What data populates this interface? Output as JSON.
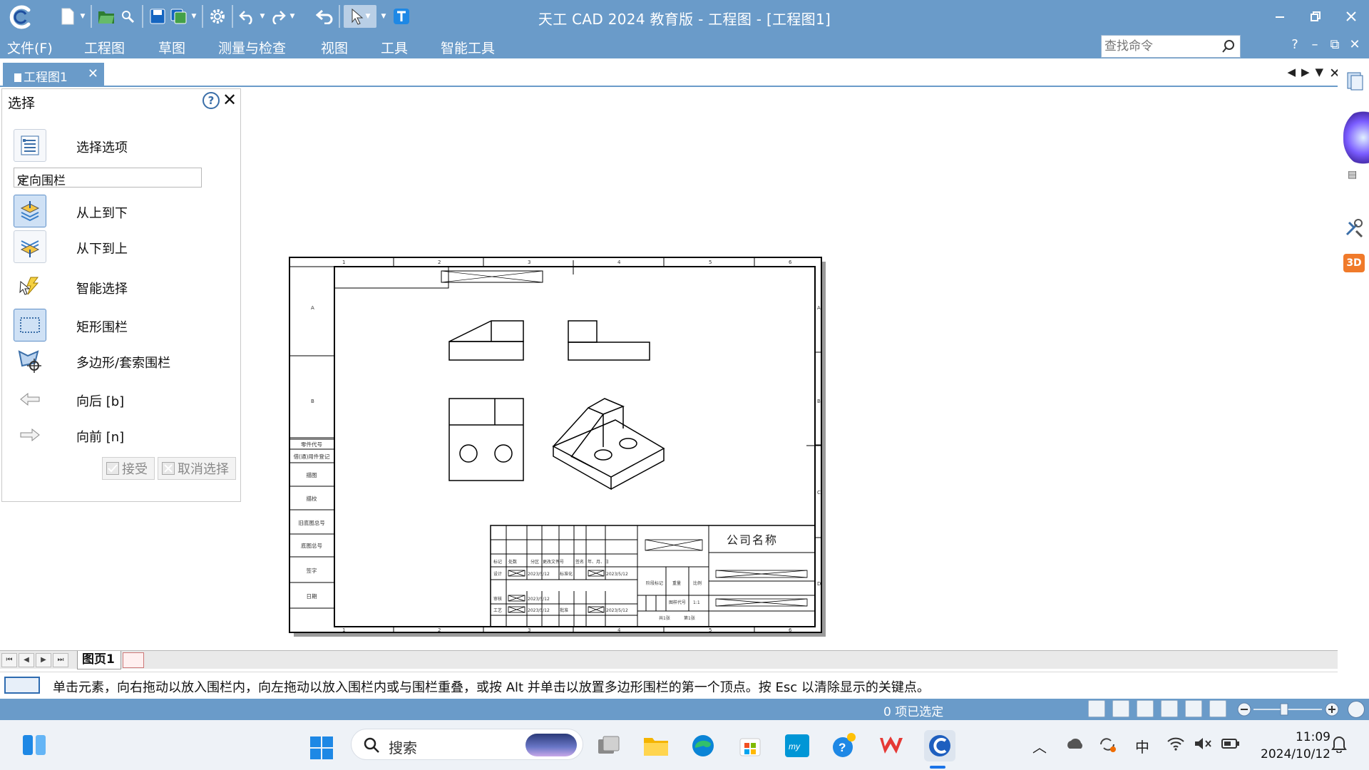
{
  "titlebar": {
    "title": "天工 CAD 2024 教育版 - 工程图 - [工程图1]",
    "icons": [
      "logo-icon",
      "new-file-icon",
      "open-icon",
      "find-icon",
      "save-icon",
      "save-all-icon",
      "settings-icon",
      "undo-icon",
      "redo-icon",
      "back-icon",
      "select-arrow-icon",
      "text-icon"
    ],
    "window_controls": [
      "minimize",
      "restore",
      "close"
    ]
  },
  "menubar": {
    "items": [
      "文件(F)",
      "工程图",
      "草图",
      "测量与检查",
      "视图",
      "工具",
      "智能工具"
    ],
    "search_placeholder": "查找命令",
    "right_controls": [
      "?",
      "–",
      "⧉",
      "✕"
    ]
  },
  "doc_tabs": [
    {
      "label": "工程图1",
      "active": true
    }
  ],
  "panel": {
    "title": "选择",
    "help": "?",
    "select_options_label": "选择选项",
    "fence_mode": "定向围栏",
    "tools": [
      {
        "label": "从上到下",
        "icon": "top-down-icon",
        "active": true
      },
      {
        "label": "从下到上",
        "icon": "bottom-up-icon",
        "active": false
      },
      {
        "label": "智能选择",
        "icon": "smart-select-icon",
        "active": false
      },
      {
        "label": "矩形围栏",
        "icon": "rect-fence-icon",
        "active": true
      },
      {
        "label": "多边形/套索围栏",
        "icon": "polygon-lasso-icon",
        "active": false
      },
      {
        "label": "向后 [b]",
        "icon": "back-arrow-icon",
        "active": false
      },
      {
        "label": "向前 [n]",
        "icon": "forward-arrow-icon",
        "active": false
      }
    ],
    "accept_label": "接受",
    "cancel_label": "取消选择"
  },
  "drawing": {
    "company_name": "公司名称",
    "col_numbers": [
      "1",
      "2",
      "3",
      "4",
      "5",
      "6"
    ],
    "row_letters": [
      "A",
      "B",
      "C",
      "D"
    ],
    "side_labels": [
      "零件代号",
      "借(通)用件登记",
      "描图",
      "描校",
      "旧底图总号",
      "底图总号",
      "签字",
      "日期"
    ],
    "title_block": {
      "mark": "标记",
      "count": "处数",
      "zone": "分区",
      "change_doc": "更改文件号",
      "sign": "签名",
      "ymd": "年、月、日",
      "design": "设计",
      "standard": "标准化",
      "review": "审核",
      "process": "工艺",
      "approve": "批准",
      "date": "2023/5/12",
      "stage_mark": "阶段标记",
      "weight": "重量",
      "scale": "比例",
      "scale_value": "1:1",
      "layout": "共1张",
      "sheet": "第1张",
      "drawing_num": "图样代号"
    }
  },
  "page_tabs": {
    "active": "图页1"
  },
  "prompt": {
    "text": "单击元素，向右拖动以放入围栏内，向左拖动以放入围栏内或与围栏重叠，或按 Alt 并单击以放置多边形围栏的第一个顶点。按 Esc 以清除显示的关键点。"
  },
  "status": {
    "selection": "0 项已选定"
  },
  "taskbar": {
    "search_placeholder": "搜索",
    "apps": [
      "widgets-icon",
      "start-icon",
      "task-view-icon",
      "file-explorer-icon",
      "edge-icon",
      "store-icon",
      "myhp-icon",
      "help-icon",
      "wps-icon",
      "tiangong-cad-icon"
    ],
    "tray_ime": "中",
    "clock_time": "11:09",
    "clock_date": "2024/10/12"
  },
  "colors": {
    "accent": "#6a9bc9",
    "panel_active": "#cfe1f5"
  }
}
